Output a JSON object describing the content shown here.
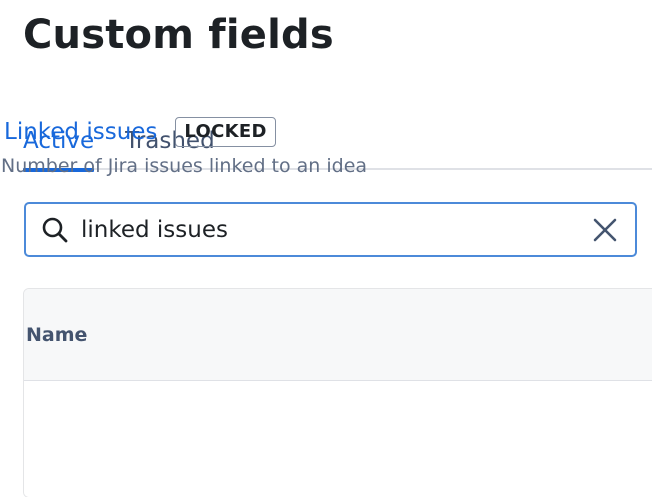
{
  "page": {
    "title": "Custom fields"
  },
  "tabs": [
    {
      "label": "Active",
      "active": true
    },
    {
      "label": "Trashed",
      "active": false
    }
  ],
  "search": {
    "value": "linked issues",
    "placeholder": ""
  },
  "table": {
    "columns": [
      "Name"
    ],
    "rows": [
      {
        "name": "Linked issues",
        "badge": "LOCKED",
        "description": "Number of Jira issues linked to an idea"
      }
    ]
  },
  "colors": {
    "accent": "#1868db",
    "focus_border": "#4c8ad9",
    "header_bg": "#f7f8f9"
  },
  "icons": {
    "search": "search-icon",
    "clear": "close-icon"
  }
}
